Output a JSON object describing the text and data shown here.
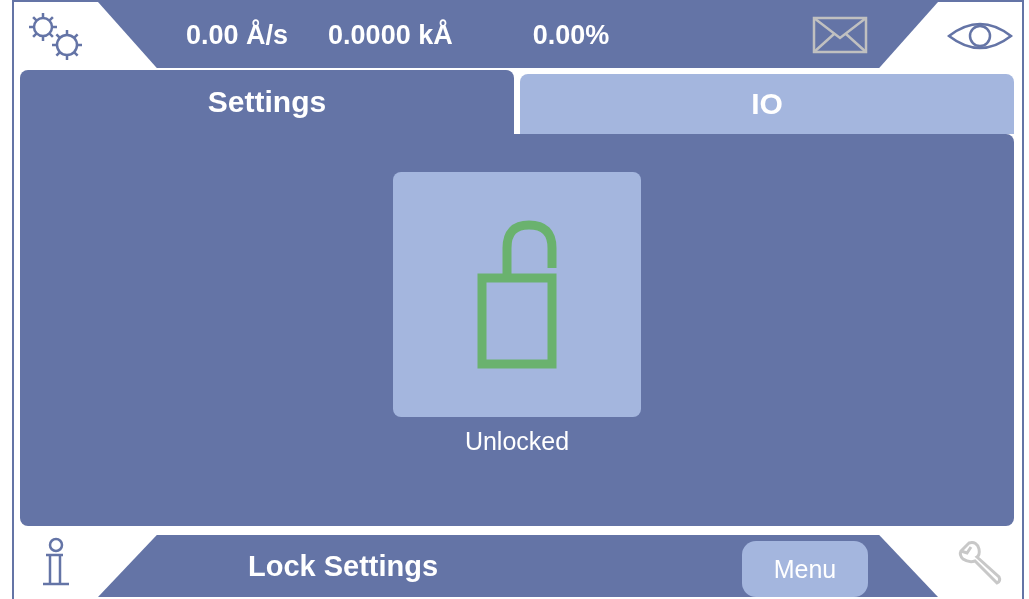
{
  "header": {
    "readings": [
      "0.00 Å/s",
      "0.0000 kÅ",
      "0.00%"
    ]
  },
  "tabs": [
    {
      "label": "Settings",
      "selected": true
    },
    {
      "label": "IO",
      "selected": false
    }
  ],
  "lock": {
    "locked": false,
    "status": "Unlocked"
  },
  "footer": {
    "title": "Lock Settings",
    "menu_button": "Menu"
  }
}
